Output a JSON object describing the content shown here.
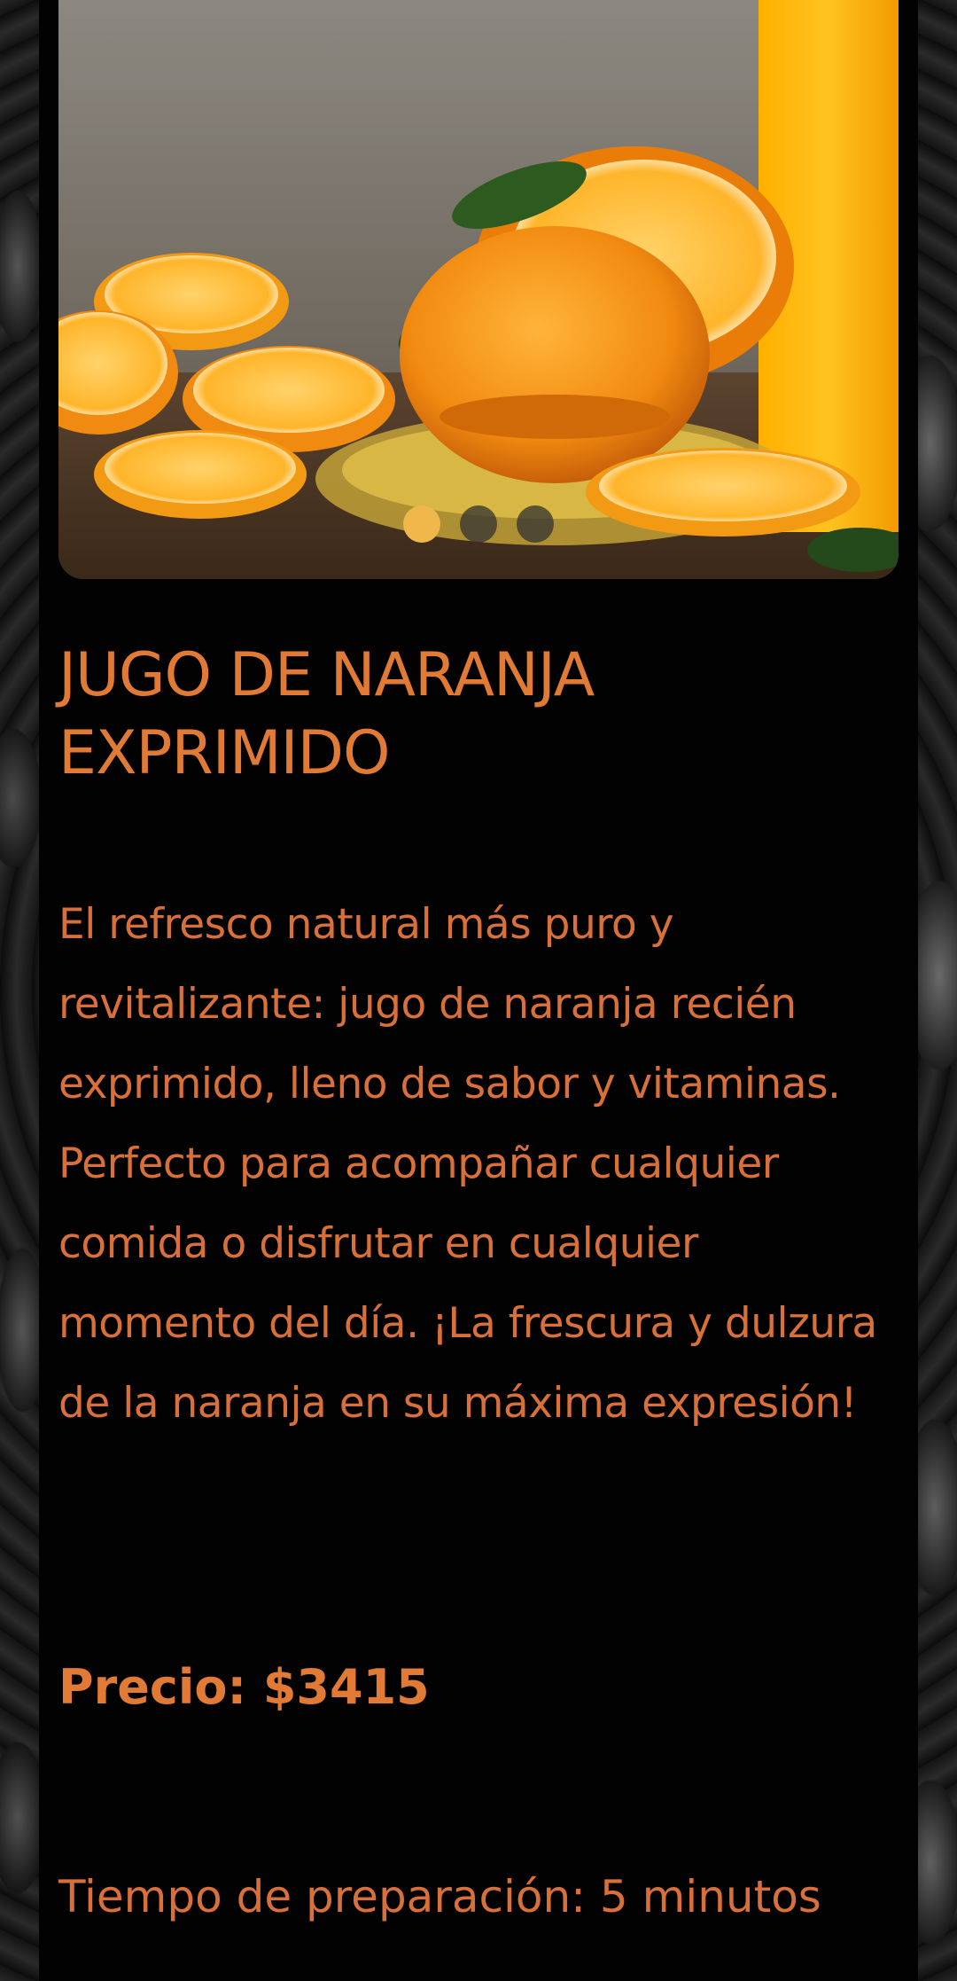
{
  "product": {
    "title": "JUGO DE NARANJA EXPRIMIDO",
    "description": "El refresco natural más puro y revitalizante: jugo de naranja recién exprimido, lleno de sabor y vitaminas. Perfecto para acompañar cualquier comida o disfrutar en cualquier momento del día. ¡La frescura y dulzura de la naranja en su máxima expresión!",
    "price_label": "Precio: $3415",
    "prep_time_label": "Tiempo de preparación: 5 minutos"
  },
  "carousel": {
    "image_name": "orange-juice-photo",
    "slide_count": 3,
    "active_index": 0
  },
  "colors": {
    "accent": "#e07a34",
    "text": "#d9703a",
    "card_bg": "#020202",
    "dot_active": "#f0b84a",
    "dot_inactive": "#323232"
  }
}
